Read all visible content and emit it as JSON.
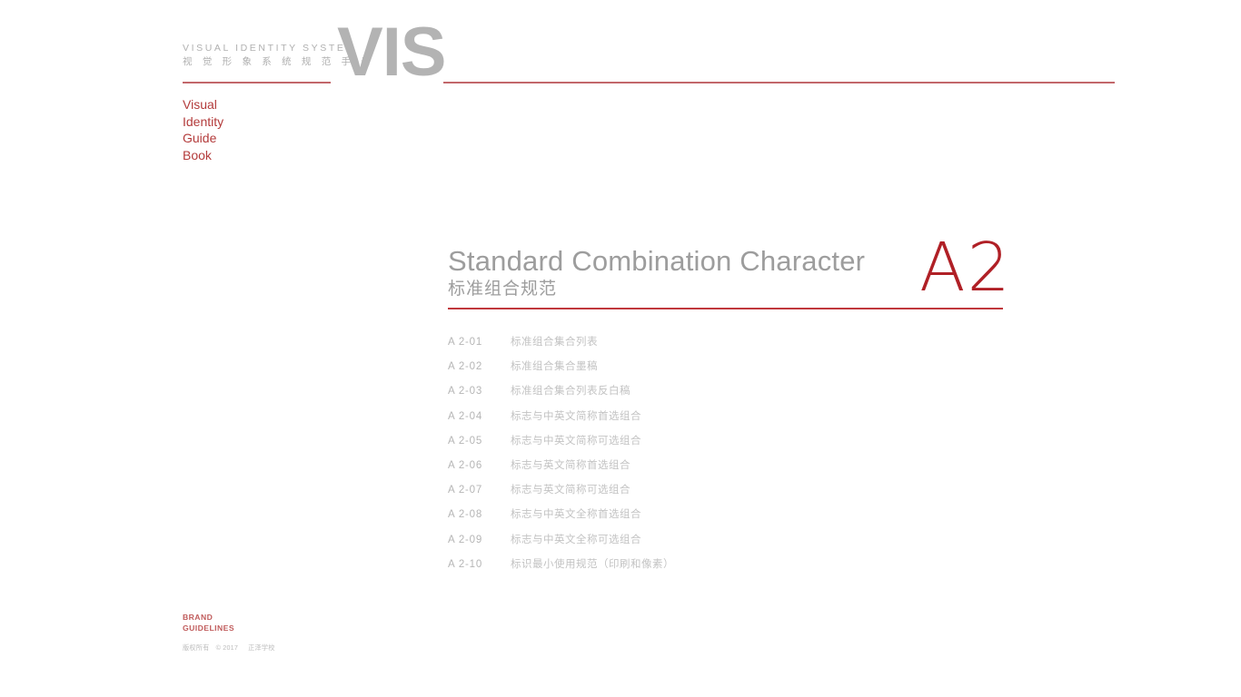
{
  "masthead": {
    "en_title": "VISUAL  IDENTITY  SYSTEM",
    "cn_title": "视 觉 形 象 系 统 规 范 手 册",
    "logo": "VIS"
  },
  "side_title": {
    "line1": "Visual",
    "line2": "Identity",
    "line3": "Guide",
    "line4": "Book"
  },
  "section": {
    "title_en": "Standard Combination Character",
    "title_cn": "标准组合规范",
    "code": "A2"
  },
  "index": {
    "items": [
      {
        "code": "A 2-01",
        "label": "标准组合集合列表"
      },
      {
        "code": "A 2-02",
        "label": "标准组合集合墨稿"
      },
      {
        "code": "A 2-03",
        "label": "标准组合集合列表反白稿"
      },
      {
        "code": "A 2-04",
        "label": "标志与中英文简称首选组合"
      },
      {
        "code": "A 2-05",
        "label": "标志与中英文简称可选组合"
      },
      {
        "code": "A 2-06",
        "label": "标志与英文简称首选组合"
      },
      {
        "code": "A 2-07",
        "label": "标志与英文简称可选组合"
      },
      {
        "code": "A 2-08",
        "label": "标志与中英文全称首选组合"
      },
      {
        "code": "A 2-09",
        "label": "标志与中英文全称可选组合"
      },
      {
        "code": "A 2-10",
        "label": "标识最小使用规范（印刷和像素）"
      }
    ]
  },
  "footer": {
    "brand_line1": "BRAND",
    "brand_line2": "GUIDELINES",
    "copyright_text": "版权所有",
    "copyright_symbol": "©",
    "copyright_year": "2017",
    "copyright_owner": "正泽学校"
  },
  "colors": {
    "accent_red": "#b02026",
    "rule_red": "#c2676a",
    "heading_gray": "#9d9d9d",
    "logo_gray": "#b3b3b3",
    "list_gray": "#c3c3c3",
    "side_title_red": "#b33b3b",
    "background": "#ffffff"
  }
}
